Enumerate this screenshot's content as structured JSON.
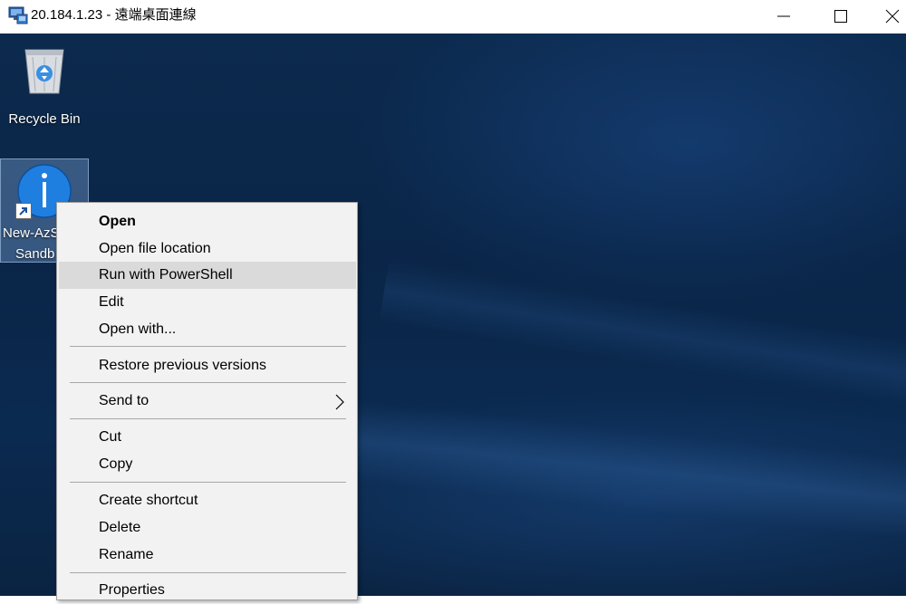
{
  "window": {
    "title": "20.184.1.23 - 遠端桌面連線",
    "controls": [
      "minimize-icon",
      "maximize-icon",
      "close-icon"
    ]
  },
  "desktop": {
    "icons": [
      {
        "label": "Recycle Bin",
        "icon": "recycle-bin-icon"
      },
      {
        "label_line1": "New-AzS",
        "label_line2": "Sandb",
        "icon": "info-script-icon",
        "selected": true
      }
    ]
  },
  "context_menu": {
    "items": [
      {
        "label": "Open",
        "bold": true
      },
      {
        "label": "Open file location"
      },
      {
        "label": "Run with PowerShell",
        "highlighted": true
      },
      {
        "label": "Edit"
      },
      {
        "label": "Open with..."
      },
      {
        "label": "Restore previous versions"
      },
      {
        "label": "Send to",
        "has_submenu": true
      },
      {
        "label": "Cut"
      },
      {
        "label": "Copy"
      },
      {
        "label": "Create shortcut"
      },
      {
        "label": "Delete"
      },
      {
        "label": "Rename"
      },
      {
        "label": "Properties"
      }
    ]
  },
  "colors": {
    "menu_bg": "#f2f2f2",
    "menu_highlight": "#dadada",
    "desktop_bg": "#0b2a50"
  }
}
